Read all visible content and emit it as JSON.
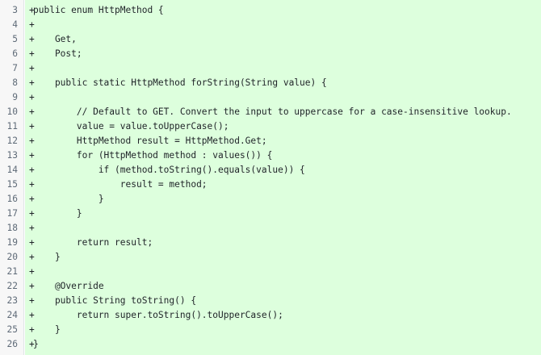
{
  "diff": {
    "lines": [
      {
        "num": "3",
        "marker": "+",
        "code": "public enum HttpMethod {"
      },
      {
        "num": "4",
        "marker": "+",
        "code": ""
      },
      {
        "num": "5",
        "marker": "+",
        "code": "    Get,"
      },
      {
        "num": "6",
        "marker": "+",
        "code": "    Post;"
      },
      {
        "num": "7",
        "marker": "+",
        "code": ""
      },
      {
        "num": "8",
        "marker": "+",
        "code": "    public static HttpMethod forString(String value) {"
      },
      {
        "num": "9",
        "marker": "+",
        "code": ""
      },
      {
        "num": "10",
        "marker": "+",
        "code": "        // Default to GET. Convert the input to uppercase for a case-insensitive lookup."
      },
      {
        "num": "11",
        "marker": "+",
        "code": "        value = value.toUpperCase();"
      },
      {
        "num": "12",
        "marker": "+",
        "code": "        HttpMethod result = HttpMethod.Get;"
      },
      {
        "num": "13",
        "marker": "+",
        "code": "        for (HttpMethod method : values()) {"
      },
      {
        "num": "14",
        "marker": "+",
        "code": "            if (method.toString().equals(value)) {"
      },
      {
        "num": "15",
        "marker": "+",
        "code": "                result = method;"
      },
      {
        "num": "16",
        "marker": "+",
        "code": "            }"
      },
      {
        "num": "17",
        "marker": "+",
        "code": "        }"
      },
      {
        "num": "18",
        "marker": "+",
        "code": ""
      },
      {
        "num": "19",
        "marker": "+",
        "code": "        return result;"
      },
      {
        "num": "20",
        "marker": "+",
        "code": "    }"
      },
      {
        "num": "21",
        "marker": "+",
        "code": ""
      },
      {
        "num": "22",
        "marker": "+",
        "code": "    @Override"
      },
      {
        "num": "23",
        "marker": "+",
        "code": "    public String toString() {"
      },
      {
        "num": "24",
        "marker": "+",
        "code": "        return super.toString().toUpperCase();"
      },
      {
        "num": "25",
        "marker": "+",
        "code": "    }"
      },
      {
        "num": "26",
        "marker": "+",
        "code": "}"
      }
    ]
  },
  "colors": {
    "added_line_background": "#ddffdd",
    "gutter_background": "#f7f7f7",
    "line_number_text": "#5f6b78",
    "code_text": "#1f2328"
  }
}
